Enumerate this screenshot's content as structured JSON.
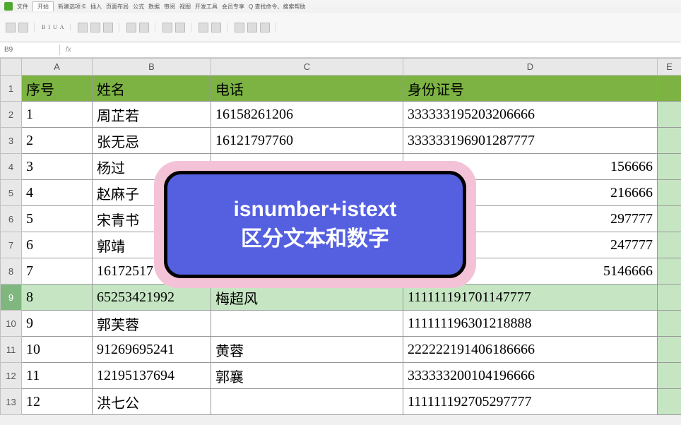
{
  "ribbon": {
    "tabs": [
      "文件",
      "开始",
      "新建选项卡",
      "插入",
      "页面布局",
      "公式",
      "数据",
      "审阅",
      "视图",
      "开发工具",
      "会员专享",
      "Q 查找命令、搜索帮助"
    ],
    "tool_labels": [
      "B",
      "I",
      "U",
      "A"
    ],
    "name_box": "B9",
    "fx": "fx"
  },
  "columns": {
    "a": "A",
    "b": "B",
    "c": "C",
    "d": "D",
    "e": "E"
  },
  "headers": {
    "序号": "序号",
    "姓名": "姓名",
    "电话": "电话",
    "身份证号": "身份证号"
  },
  "rows": [
    {
      "n": "1",
      "a": "序号",
      "b": "姓名",
      "c": "电话",
      "d": "身份证号",
      "header": true
    },
    {
      "n": "2",
      "a": "1",
      "b": "周芷若",
      "c": "16158261206",
      "d": "333333195203206666"
    },
    {
      "n": "3",
      "a": "2",
      "b": "张无忌",
      "c": "16121797760",
      "d": "333333196901287777"
    },
    {
      "n": "4",
      "a": "3",
      "b": "杨过",
      "c": "",
      "d": "156666",
      "partial_d": true
    },
    {
      "n": "5",
      "a": "4",
      "b": "赵麻子",
      "c": "",
      "d": "216666",
      "partial_d": true
    },
    {
      "n": "6",
      "a": "5",
      "b": "宋青书",
      "c": "",
      "d": "297777",
      "partial_d": true
    },
    {
      "n": "7",
      "a": "6",
      "b": "郭靖",
      "c": "",
      "d": "247777",
      "partial_d": true
    },
    {
      "n": "8",
      "a": "7",
      "b": "16172517",
      "c": "",
      "d": "5146666",
      "partial_d": true,
      "partial_b": true
    },
    {
      "n": "9",
      "a": "8",
      "b": "65253421992",
      "c": "梅超风",
      "d": "111111191701147777",
      "selected": true
    },
    {
      "n": "10",
      "a": "9",
      "b": "郭芙蓉",
      "c": "",
      "d": "111111196301218888"
    },
    {
      "n": "11",
      "a": "10",
      "b": "91269695241",
      "c": "黄蓉",
      "d": "222222191406186666"
    },
    {
      "n": "12",
      "a": "11",
      "b": "12195137694",
      "c": "郭襄",
      "d": "333333200104196666"
    },
    {
      "n": "13",
      "a": "12",
      "b": "洪七公",
      "c": "",
      "d": "111111192705297777"
    }
  ],
  "overlay": {
    "line1": "isnumber+istext",
    "line2": "区分文本和数字"
  }
}
